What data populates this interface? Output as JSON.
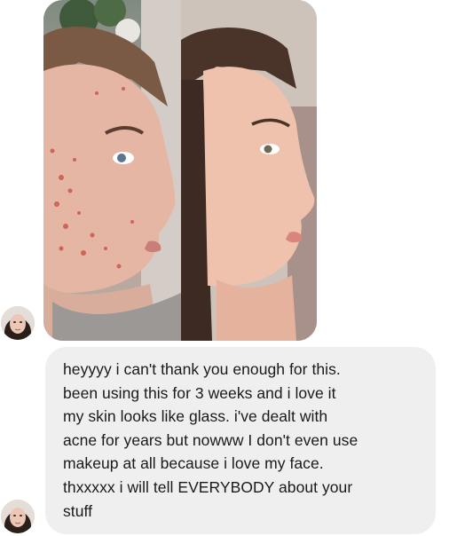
{
  "conversation": {
    "photo_message": {
      "left_image": "before-acne-photo",
      "right_image": "after-clear-skin-photo"
    },
    "text_message": {
      "text": "heyyyy i can't thank you enough for this.\nbeen using this for 3 weeks and i love it\nmy skin looks like glass. i've dealt with\nacne for years but nowww I don't even use\nmakeup at all because i love my face.\nthxxxxx i will tell EVERYBODY about your\nstuff"
    },
    "colors": {
      "bubble_background": "#efefef",
      "text": "#1a1a1a",
      "page_background": "#ffffff"
    },
    "icons": [
      "sender-avatar",
      "sender-avatar"
    ]
  }
}
